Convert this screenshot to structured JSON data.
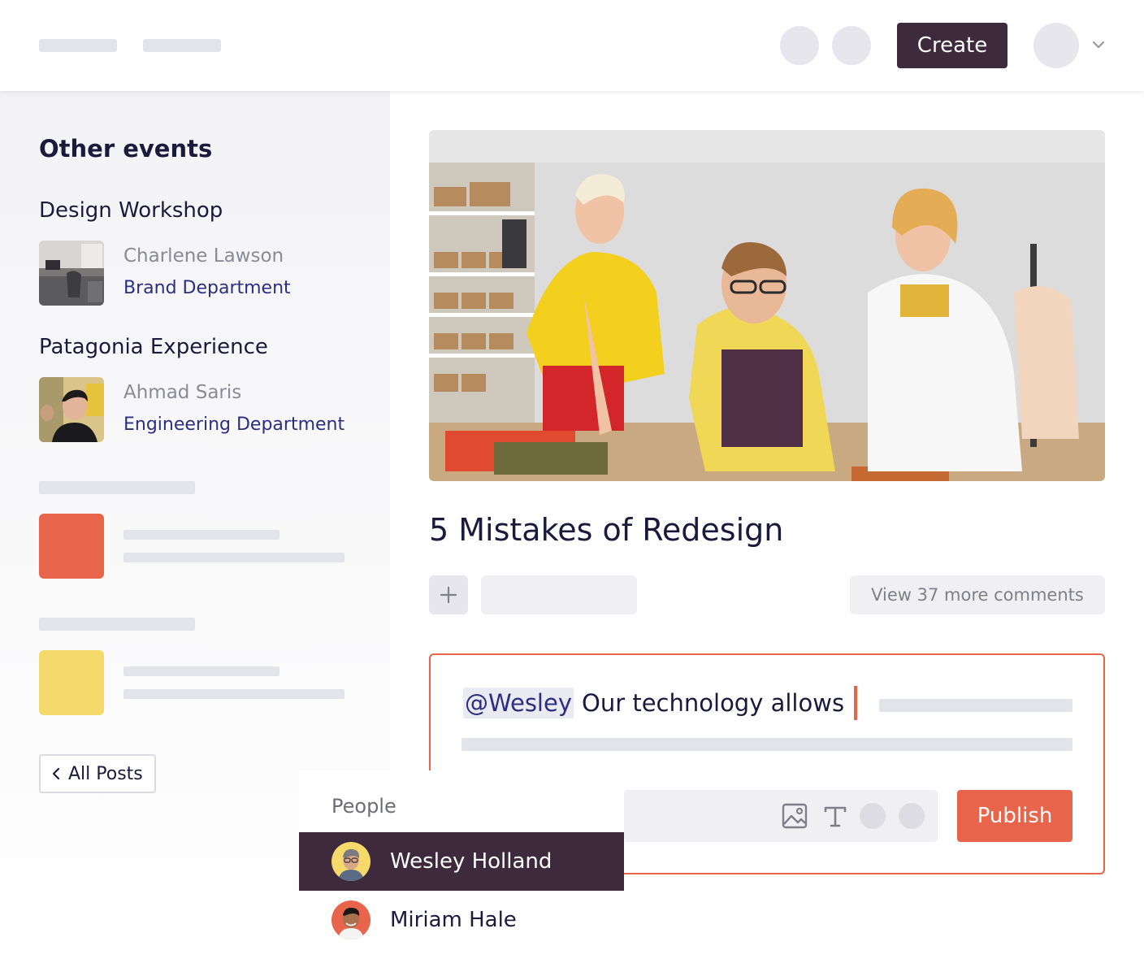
{
  "header": {
    "create_label": "Create"
  },
  "sidebar": {
    "title": "Other events",
    "events": [
      {
        "title": "Design Workshop",
        "person": "Charlene Lawson",
        "department": "Brand Department"
      },
      {
        "title": "Patagonia Experience",
        "person": "Ahmad Saris",
        "department": "Engineering Department"
      }
    ],
    "all_posts_label": "All Posts"
  },
  "main": {
    "post_title": "5 Mistakes of Redesign",
    "more_comments_label": "View 37 more comments",
    "editor": {
      "mention": "@Wesley",
      "text": "Our technology allows",
      "publish_label": "Publish"
    }
  },
  "popover": {
    "heading": "People",
    "people": [
      {
        "name": "Wesley Holland",
        "selected": true
      },
      {
        "name": "Miriam Hale",
        "selected": false
      }
    ]
  },
  "colors": {
    "accent": "#e8644a",
    "dark": "#3e2a3d",
    "link": "#2c2f80",
    "red_square": "#e8644a",
    "yellow_square": "#f5d96b"
  }
}
